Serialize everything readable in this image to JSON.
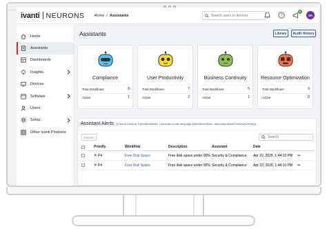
{
  "header": {
    "brand": "ivanti",
    "product": "NEURONS",
    "breadcrumb": {
      "home": "Home",
      "separator": "/",
      "current": "Assistants"
    },
    "search_placeholder": "Search users or devices",
    "notification_count": "8",
    "user_initials": "SK"
  },
  "sidebar": {
    "items": [
      {
        "label": "Home",
        "icon": "home-icon"
      },
      {
        "label": "Assistants",
        "icon": "assistant-icon",
        "active": true
      },
      {
        "label": "Dashboards",
        "icon": "dashboard-icon"
      },
      {
        "label": "Insights",
        "icon": "insights-icon"
      },
      {
        "label": "Devices",
        "icon": "devices-icon"
      },
      {
        "label": "Software",
        "icon": "software-icon"
      },
      {
        "label": "Users",
        "icon": "users-icon"
      },
      {
        "label": "Setup",
        "icon": "setup-icon"
      },
      {
        "label": "Other Ivanti Products",
        "icon": "grid-icon"
      }
    ]
  },
  "main": {
    "title": "Assistants",
    "library_button": "Library",
    "audit_button": "Audit History",
    "cards": [
      {
        "name": "Compliance",
        "color": "#4fc3f7",
        "total_label": "Total Workflows:",
        "total": "8",
        "active_label": "Active",
        "active": "1"
      },
      {
        "name": "User Productivity",
        "color": "#fdd835",
        "total_label": "Total Workflows:",
        "total": "7",
        "active_label": "Active",
        "active": "2"
      },
      {
        "name": "Business Continuity",
        "color": "#8bc34a",
        "total_label": "Total Workflows:",
        "total": "5",
        "active_label": "Active",
        "active": "1"
      },
      {
        "name": "Resource Optimization",
        "color": "#ff7043",
        "total_label": "Total Workflows:",
        "total": "6",
        "active_label": "Active",
        "active": "0"
      }
    ],
    "alerts": {
      "title": "Assistant Alerts",
      "template_text": "{{'Home.AlertList.FailedWorkflows' | translate:locale.language:{failedWorkflows: stats.daily.failedWorkflows24Hrs}}}",
      "actions_label": "Actions",
      "search_placeholder": "Search",
      "columns": [
        "Priority",
        "Workflow",
        "Description",
        "Assistant",
        "Date"
      ],
      "rows": [
        {
          "priority": "P4",
          "workflow": "Free Disk Space",
          "description": "Free disk space under 90%",
          "assistant": "Security & Compliance",
          "date": "Apr 22, 2020, 1:44:10 PM"
        },
        {
          "priority": "P4",
          "workflow": "Free Disk Space",
          "description": "Free disk space under 90%",
          "assistant": "Security & Compliance",
          "date": "Apr 22, 2020, 1:44:10 PM"
        }
      ]
    }
  }
}
